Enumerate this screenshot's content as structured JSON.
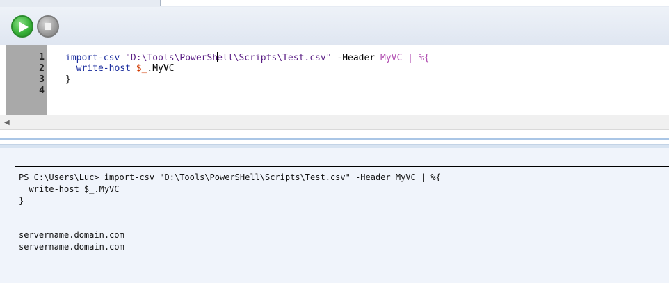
{
  "toolbar": {
    "run_icon": "play-icon",
    "stop_icon": "stop-icon"
  },
  "editor": {
    "line_numbers": [
      "1",
      "2",
      "3",
      "4"
    ],
    "line1": {
      "cmd": "import-csv",
      "str_before_caret": "\"D:\\Tools\\PowerSh",
      "str_after_caret": "ell\\Scripts\\Test.csv\"",
      "param": "-Header",
      "value": "MyVC",
      "pipe": "|",
      "foreach": "%{"
    },
    "line2": {
      "cmd": "write-host",
      "var": "$_",
      "member": ".MyVC"
    },
    "line3": "}",
    "line4": ""
  },
  "console": {
    "lines": [
      "PS C:\\Users\\Luc> import-csv \"D:\\Tools\\PowerSHell\\Scripts\\Test.csv\" -Header MyVC | %{",
      "  write-host $_.MyVC",
      "}",
      "",
      "servername.domain.com",
      "servername.domain.com"
    ]
  },
  "colors": {
    "keyword": "#1c2e9e",
    "string": "#5a1e84",
    "variable": "#d23b00",
    "console_bg": "#f0f4fb"
  }
}
